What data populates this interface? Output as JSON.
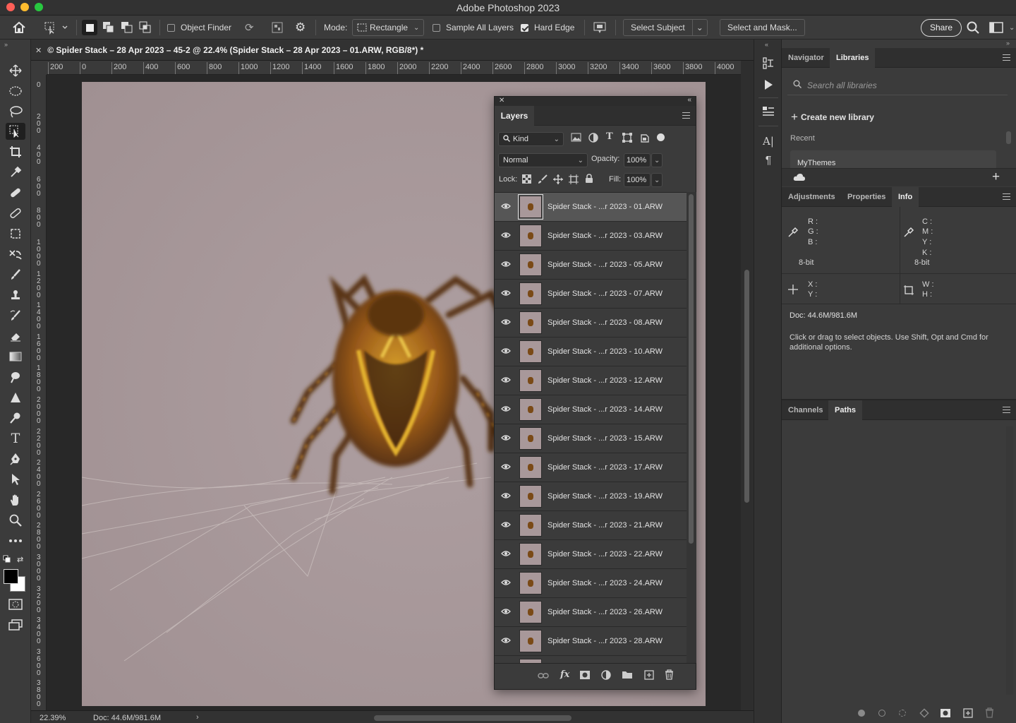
{
  "app": {
    "title": "Adobe Photoshop 2023"
  },
  "options_bar": {
    "object_finder": "Object Finder",
    "mode_label": "Mode:",
    "mode_value": "Rectangle",
    "sample_all_layers": "Sample All Layers",
    "hard_edge": "Hard Edge",
    "select_subject": "Select Subject",
    "select_and_mask": "Select and Mask...",
    "share": "Share"
  },
  "document": {
    "tab_title": "© Spider Stack – 28 Apr 2023 – 45-2 @ 22.4% (Spider Stack – 28 Apr 2023 – 01.ARW, RGB/8*) *",
    "zoom": "22.39%",
    "doc_size": "Doc: 44.6M/981.6M"
  },
  "ruler": {
    "h_ticks": [
      "200",
      "0",
      "200",
      "400",
      "600",
      "800",
      "1000",
      "1200",
      "1400",
      "1600",
      "1800",
      "2000",
      "2200",
      "2400",
      "2600",
      "2800",
      "3000",
      "3200",
      "3400",
      "3600",
      "3800",
      "4000"
    ],
    "v_ticks": [
      "0",
      "200",
      "400",
      "600",
      "800",
      "1000",
      "1200",
      "1400",
      "1600",
      "1800",
      "2000",
      "2200",
      "2400",
      "2600",
      "2800",
      "3000",
      "3200",
      "3400",
      "3600",
      "3800"
    ]
  },
  "layers_panel": {
    "tab": "Layers",
    "kind": "Kind",
    "blend_mode": "Normal",
    "opacity_label": "Opacity:",
    "opacity_value": "100%",
    "lock_label": "Lock:",
    "fill_label": "Fill:",
    "fill_value": "100%",
    "layers": [
      "Spider Stack - ...r 2023 - 01.ARW",
      "Spider Stack - ...r 2023 - 03.ARW",
      "Spider Stack - ...r 2023 - 05.ARW",
      "Spider Stack - ...r 2023 - 07.ARW",
      "Spider Stack - ...r 2023 - 08.ARW",
      "Spider Stack - ...r 2023 - 10.ARW",
      "Spider Stack - ...r 2023 - 12.ARW",
      "Spider Stack - ...r 2023 - 14.ARW",
      "Spider Stack - ...r 2023 - 15.ARW",
      "Spider Stack - ...r 2023 - 17.ARW",
      "Spider Stack - ...r 2023 - 19.ARW",
      "Spider Stack - ...r 2023 - 21.ARW",
      "Spider Stack - ...r 2023 - 22.ARW",
      "Spider Stack - ...r 2023 - 24.ARW",
      "Spider Stack - ...r 2023 - 26.ARW",
      "Spider Stack - ...r 2023 - 28.ARW"
    ]
  },
  "right_panels": {
    "top_tabs": [
      "Navigator",
      "Libraries"
    ],
    "search_placeholder": "Search all libraries",
    "create_library": "Create new library",
    "recent": "Recent",
    "my_themes": "MyThemes",
    "mid_tabs": [
      "Adjustments",
      "Properties",
      "Info"
    ],
    "info": {
      "r": "R :",
      "g": "G :",
      "b": "B :",
      "c": "C :",
      "m": "M :",
      "y": "Y :",
      "k": "K :",
      "bit_left": "8-bit",
      "bit_right": "8-bit",
      "x": "X :",
      "yy": "Y :",
      "w": "W :",
      "h": "H :",
      "doc": "Doc: 44.6M/981.6M",
      "hint": "Click or drag to select objects.  Use Shift, Opt and Cmd for additional options."
    },
    "bottom_tabs": [
      "Channels",
      "Paths"
    ]
  },
  "colors": {
    "canvas_bg": "#a8989a",
    "panel_bg": "#3b3b3b",
    "selected_row": "#565656"
  }
}
